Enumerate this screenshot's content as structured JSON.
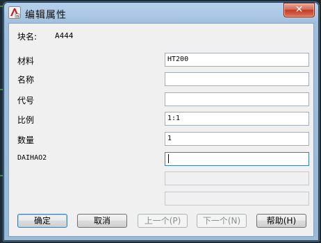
{
  "window": {
    "title": "编辑属性",
    "close_glyph": "✕"
  },
  "block": {
    "label": "块名:",
    "value": "A444"
  },
  "attributes": [
    {
      "label": "材料",
      "value": "HT200"
    },
    {
      "label": "名称",
      "value": ""
    },
    {
      "label": "代号",
      "value": ""
    },
    {
      "label": "比例",
      "value": "1:1"
    },
    {
      "label": "数量",
      "value": "1"
    },
    {
      "label": "DAIHAO2",
      "value": ""
    }
  ],
  "buttons": {
    "ok": "确定",
    "cancel": "取消",
    "prev": "上一个(P)",
    "next": "下一个(N)",
    "help": "帮助(H)"
  },
  "colors": {
    "title_bar": "#a9c6e3",
    "close_button": "#c23b23",
    "client": "#f0f0f0"
  }
}
